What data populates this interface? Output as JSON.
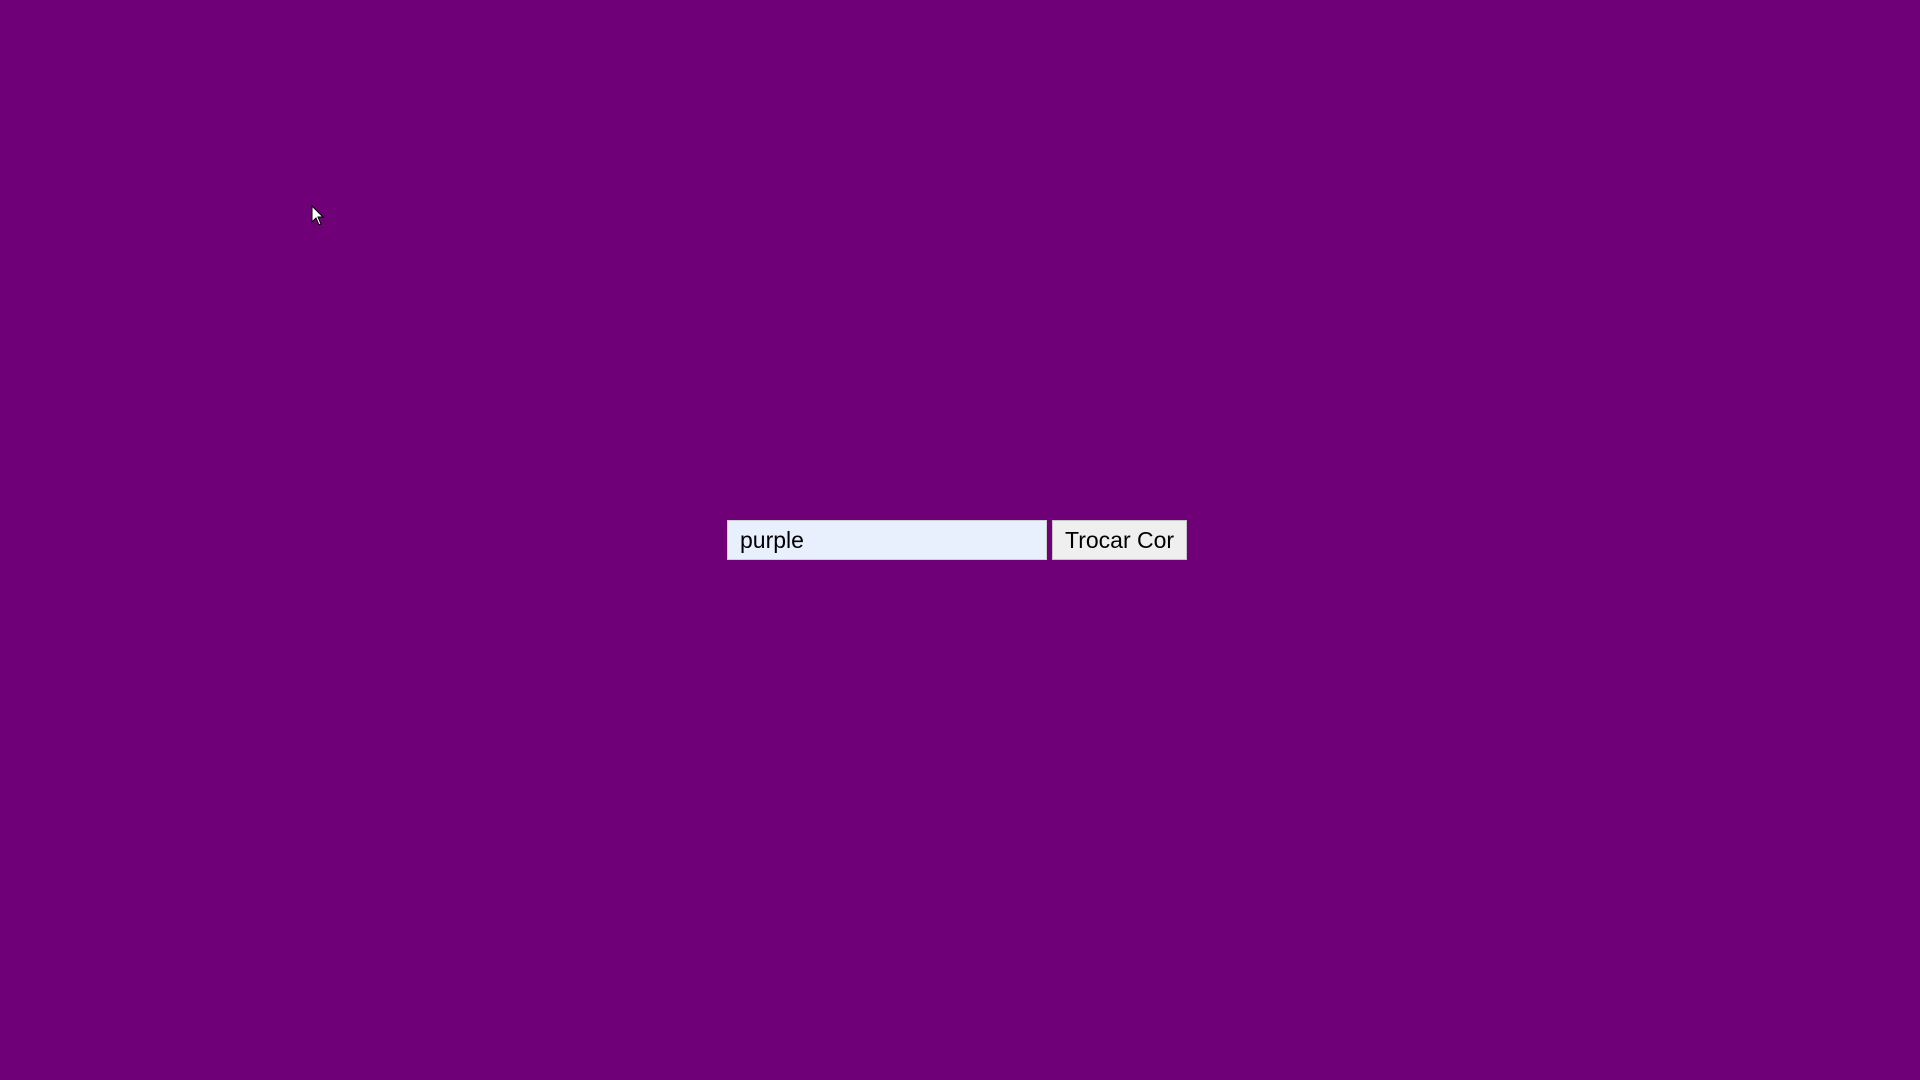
{
  "theme": {
    "background_color": "#700078"
  },
  "form": {
    "color_input_value": "purple",
    "swap_button_label": "Trocar Cor"
  },
  "cursor": {
    "icon": "mouse-pointer-icon"
  }
}
